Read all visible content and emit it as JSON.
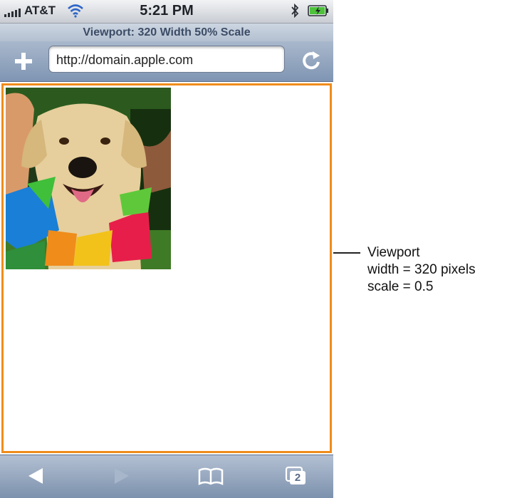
{
  "status_bar": {
    "carrier": "AT&T",
    "time": "5:21 PM",
    "icons": [
      "signal-icon",
      "wifi-icon",
      "bluetooth-icon",
      "battery-icon"
    ]
  },
  "browser": {
    "page_title": "Viewport: 320 Width 50% Scale",
    "url": "http://domain.apple.com",
    "toolbar": {
      "tab_count": "2",
      "buttons": [
        "back-icon",
        "forward-icon",
        "bookmarks-icon",
        "pages-icon"
      ]
    }
  },
  "content": {
    "image": "dog-photo"
  },
  "callout": {
    "lines": [
      "Viewport",
      "width = 320 pixels",
      "scale = 0.5"
    ]
  },
  "colors": {
    "viewport_border": "#f08c1a",
    "toolbar_blue": "#7f95b3"
  }
}
